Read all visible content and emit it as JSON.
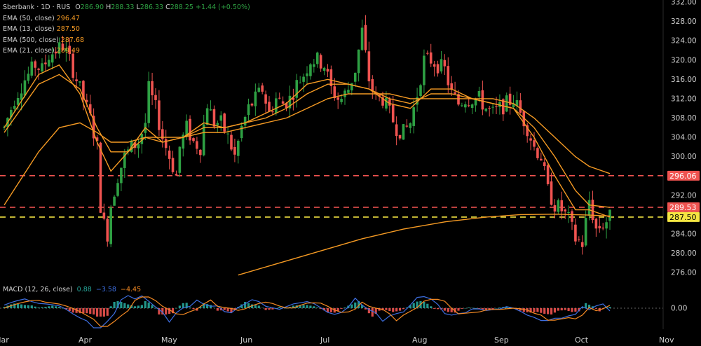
{
  "header": {
    "symbol": "Sberbank",
    "interval": "1D",
    "exchange": "RUS",
    "o_label": "O",
    "o_value": "286.90",
    "h_label": "H",
    "h_value": "288.33",
    "l_label": "L",
    "l_value": "286.33",
    "c_label": "C",
    "c_value": "288.25",
    "change": "+1.44 (+0.50%)"
  },
  "indicators": [
    {
      "label": "EMA (50, close)",
      "value": "296.47"
    },
    {
      "label": "EMA (13, close)",
      "value": "287.50"
    },
    {
      "label": "EMA (500, close)",
      "value": "287.68"
    },
    {
      "label": "EMA (21, close)",
      "value": "289.49"
    }
  ],
  "macd": {
    "label": "MACD (12, 26, close)",
    "macd_value": "0.88",
    "signal_value": "−3.58",
    "hist_value": "−4.45",
    "zero_label": "0.00"
  },
  "colors": {
    "up": "#26a69a",
    "up_candle": "#2ea043",
    "down": "#ef5350",
    "ema": "#f59a23",
    "line_red": "#ef5350",
    "line_yellow": "#f5e642",
    "macd_line": "#3d6ee0",
    "signal_line": "#f58a23"
  },
  "chart_data": {
    "type": "candlestick",
    "ylim": [
      274,
      332
    ],
    "y_ticks": [
      "276.00",
      "280.00",
      "284.00",
      "288.00",
      "292.00",
      "296.00",
      "300.00",
      "304.00",
      "308.00",
      "312.00",
      "316.00",
      "320.00",
      "324.00",
      "328.00",
      "332.00"
    ],
    "x_ticks": [
      "Mar",
      "Apr",
      "May",
      "Jun",
      "Jul",
      "Aug",
      "Sep",
      "Oct",
      "Nov"
    ],
    "price_lines": [
      {
        "value": 296.06,
        "label": "296.06",
        "color": "#ef5350"
      },
      {
        "value": 289.53,
        "label": "289.53",
        "color": "#ef5350"
      },
      {
        "value": 287.5,
        "label": "287.50",
        "color": "#f5e642"
      }
    ],
    "anchors": [
      [
        0,
        306
      ],
      [
        3,
        312
      ],
      [
        6,
        316
      ],
      [
        9,
        319
      ],
      [
        11,
        318
      ],
      [
        13,
        321
      ],
      [
        15,
        322
      ],
      [
        17,
        323
      ],
      [
        19,
        320
      ],
      [
        21,
        316
      ],
      [
        23,
        312
      ],
      [
        25,
        308
      ],
      [
        27,
        302
      ],
      [
        28,
        290
      ],
      [
        29,
        286
      ],
      [
        30,
        284
      ],
      [
        31,
        290
      ],
      [
        33,
        296
      ],
      [
        35,
        300
      ],
      [
        37,
        302
      ],
      [
        39,
        303
      ],
      [
        41,
        307
      ],
      [
        42,
        314
      ],
      [
        44,
        310
      ],
      [
        46,
        304
      ],
      [
        48,
        300
      ],
      [
        50,
        296
      ],
      [
        51,
        302
      ],
      [
        53,
        306
      ],
      [
        55,
        303
      ],
      [
        57,
        302
      ],
      [
        59,
        311
      ],
      [
        61,
        307
      ],
      [
        63,
        307
      ],
      [
        65,
        304
      ],
      [
        67,
        300
      ],
      [
        69,
        306
      ],
      [
        71,
        310
      ],
      [
        73,
        312
      ],
      [
        75,
        314
      ],
      [
        77,
        309
      ],
      [
        79,
        312
      ],
      [
        81,
        311
      ],
      [
        83,
        312
      ],
      [
        85,
        315
      ],
      [
        87,
        317
      ],
      [
        89,
        320
      ],
      [
        91,
        320
      ],
      [
        93,
        319
      ],
      [
        95,
        314
      ],
      [
        97,
        312
      ],
      [
        98,
        312
      ],
      [
        100,
        314
      ],
      [
        102,
        318
      ],
      [
        104,
        326
      ],
      [
        106,
        316
      ],
      [
        108,
        312
      ],
      [
        110,
        312
      ],
      [
        112,
        309
      ],
      [
        114,
        306
      ],
      [
        116,
        305
      ],
      [
        118,
        307
      ],
      [
        120,
        313
      ],
      [
        122,
        320
      ],
      [
        124,
        320
      ],
      [
        126,
        319
      ],
      [
        128,
        318
      ],
      [
        130,
        313
      ],
      [
        132,
        311
      ],
      [
        134,
        312
      ],
      [
        136,
        312
      ],
      [
        138,
        312
      ],
      [
        140,
        310
      ],
      [
        142,
        309
      ],
      [
        144,
        310
      ],
      [
        146,
        311
      ],
      [
        148,
        312
      ],
      [
        150,
        309
      ],
      [
        152,
        306
      ],
      [
        154,
        302
      ],
      [
        156,
        300
      ],
      [
        158,
        293
      ],
      [
        160,
        290
      ],
      [
        162,
        289
      ],
      [
        164,
        287
      ],
      [
        166,
        283
      ],
      [
        168,
        282
      ],
      [
        170,
        291
      ],
      [
        172,
        285
      ],
      [
        174,
        286
      ],
      [
        176,
        287.5
      ]
    ],
    "ema_series": [
      {
        "name": "EMA (13, close)",
        "values": [
          [
            0,
            306
          ],
          [
            10,
            317
          ],
          [
            16,
            319
          ],
          [
            22,
            313
          ],
          [
            27,
            303
          ],
          [
            31,
            297
          ],
          [
            36,
            301
          ],
          [
            41,
            306
          ],
          [
            46,
            303
          ],
          [
            52,
            304
          ],
          [
            58,
            307
          ],
          [
            64,
            306
          ],
          [
            70,
            307
          ],
          [
            76,
            309
          ],
          [
            82,
            311
          ],
          [
            88,
            315
          ],
          [
            94,
            316
          ],
          [
            100,
            315
          ],
          [
            106,
            314
          ],
          [
            112,
            311
          ],
          [
            118,
            310
          ],
          [
            124,
            314
          ],
          [
            130,
            314
          ],
          [
            136,
            312
          ],
          [
            142,
            311
          ],
          [
            148,
            310
          ],
          [
            154,
            304
          ],
          [
            160,
            296
          ],
          [
            166,
            289
          ],
          [
            170,
            289
          ],
          [
            176,
            287.5
          ]
        ]
      },
      {
        "name": "EMA (21, close)",
        "values": [
          [
            0,
            305
          ],
          [
            10,
            315
          ],
          [
            16,
            317
          ],
          [
            22,
            314
          ],
          [
            27,
            306
          ],
          [
            31,
            301
          ],
          [
            36,
            301
          ],
          [
            41,
            304
          ],
          [
            46,
            303
          ],
          [
            52,
            304
          ],
          [
            58,
            306
          ],
          [
            64,
            306
          ],
          [
            70,
            307
          ],
          [
            76,
            308
          ],
          [
            82,
            310
          ],
          [
            88,
            313
          ],
          [
            94,
            315
          ],
          [
            100,
            315
          ],
          [
            106,
            314
          ],
          [
            112,
            312
          ],
          [
            118,
            311
          ],
          [
            124,
            313
          ],
          [
            130,
            313
          ],
          [
            136,
            312
          ],
          [
            142,
            311
          ],
          [
            148,
            310
          ],
          [
            154,
            306
          ],
          [
            160,
            300
          ],
          [
            166,
            293
          ],
          [
            170,
            290
          ],
          [
            176,
            289.5
          ]
        ]
      },
      {
        "name": "EMA (50, close)",
        "values": [
          [
            0,
            290
          ],
          [
            10,
            301
          ],
          [
            16,
            306
          ],
          [
            22,
            307
          ],
          [
            27,
            305
          ],
          [
            31,
            303
          ],
          [
            36,
            303
          ],
          [
            41,
            304
          ],
          [
            46,
            304
          ],
          [
            52,
            304
          ],
          [
            58,
            305
          ],
          [
            64,
            305
          ],
          [
            70,
            306
          ],
          [
            76,
            307
          ],
          [
            82,
            308
          ],
          [
            88,
            310
          ],
          [
            94,
            312
          ],
          [
            100,
            313
          ],
          [
            106,
            313
          ],
          [
            112,
            313
          ],
          [
            118,
            312
          ],
          [
            124,
            312
          ],
          [
            130,
            312
          ],
          [
            136,
            312
          ],
          [
            142,
            312
          ],
          [
            148,
            311
          ],
          [
            154,
            308
          ],
          [
            160,
            304
          ],
          [
            166,
            300
          ],
          [
            170,
            298
          ],
          [
            176,
            296.5
          ]
        ]
      },
      {
        "name": "EMA (500, close)",
        "values": [
          [
            68,
            275.5
          ],
          [
            80,
            278
          ],
          [
            92,
            280.5
          ],
          [
            104,
            283
          ],
          [
            116,
            285
          ],
          [
            128,
            286.5
          ],
          [
            140,
            287.5
          ],
          [
            150,
            288
          ],
          [
            160,
            288.1
          ],
          [
            170,
            287.9
          ],
          [
            176,
            287.7
          ]
        ]
      }
    ]
  }
}
